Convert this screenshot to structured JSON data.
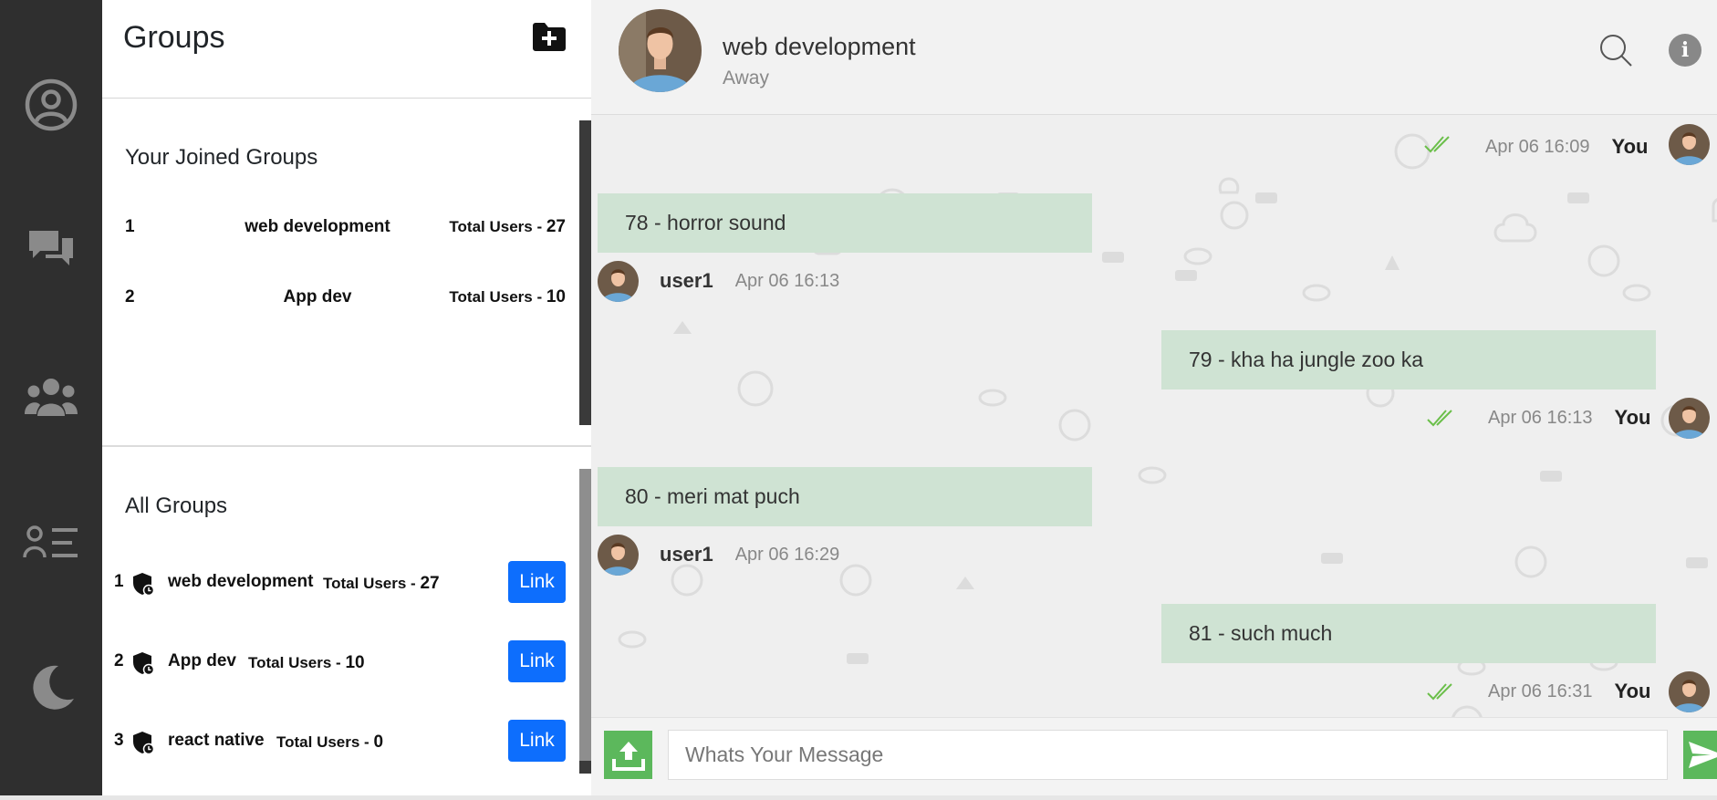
{
  "rail": {
    "icons": [
      "profile-icon",
      "chats-icon",
      "groups-icon",
      "contacts-icon",
      "dark-mode-icon"
    ]
  },
  "panel": {
    "title": "Groups",
    "new_group_icon": "folder-plus-icon",
    "joined": {
      "title": "Your Joined Groups",
      "rows": [
        {
          "index": "1",
          "name": "web development",
          "users_label": "Total Users - ",
          "users": "27"
        },
        {
          "index": "2",
          "name": "App dev",
          "users_label": "Total Users - ",
          "users": "10"
        }
      ]
    },
    "all": {
      "title": "All Groups",
      "rows": [
        {
          "index": "1",
          "name": "web development",
          "users_label": "Total Users - ",
          "users": "27",
          "button": "Link"
        },
        {
          "index": "2",
          "name": "App dev",
          "users_label": "Total Users - ",
          "users": "10",
          "button": "Link"
        },
        {
          "index": "3",
          "name": "react native",
          "users_label": "Total Users - ",
          "users": "0",
          "button": "Link"
        }
      ]
    }
  },
  "chat": {
    "name": "web development",
    "status": "Away",
    "messages": [
      {
        "side": "right",
        "text": "",
        "time": "Apr 06 16:09",
        "sender": "You"
      },
      {
        "side": "left",
        "text": "78 - horror sound",
        "time": "Apr 06 16:13",
        "sender": "user1"
      },
      {
        "side": "right",
        "text": "79 - kha ha jungle zoo ka",
        "time": "Apr 06 16:13",
        "sender": "You"
      },
      {
        "side": "left",
        "text": "80 - meri mat puch",
        "time": "Apr 06 16:29",
        "sender": "user1"
      },
      {
        "side": "right",
        "text": "81 - such much",
        "time": "Apr 06 16:31",
        "sender": "You"
      }
    ],
    "input_placeholder": "Whats Your Message",
    "colors": {
      "bubble": "#cfe3d3",
      "accent": "#5cb85c",
      "link": "#0d6efd",
      "rail": "#2f2f2f"
    }
  }
}
